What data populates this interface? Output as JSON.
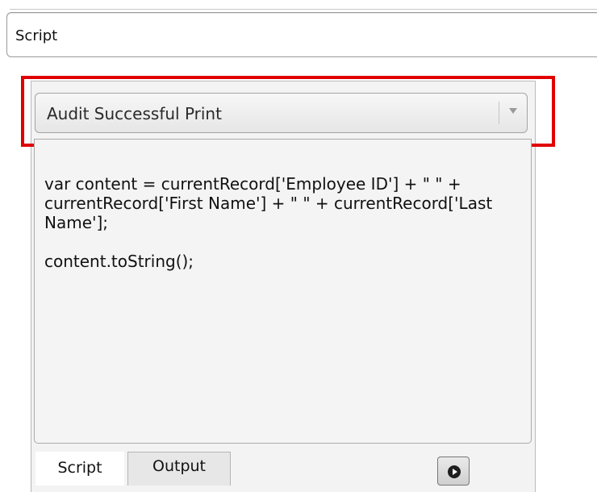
{
  "field": {
    "label": "Script"
  },
  "dropdown": {
    "selected": "Audit Successful Print"
  },
  "editor": {
    "code": "var content = currentRecord['Employee ID'] + \" \" + currentRecord['First Name'] + \" \" + currentRecord['Last Name'];\n\ncontent.toString();"
  },
  "tabs": [
    {
      "label": "Script",
      "active": true
    },
    {
      "label": "Output",
      "active": false
    }
  ],
  "run_button": {
    "icon": "play-circle-icon"
  },
  "colors": {
    "highlight": "#e00000"
  }
}
